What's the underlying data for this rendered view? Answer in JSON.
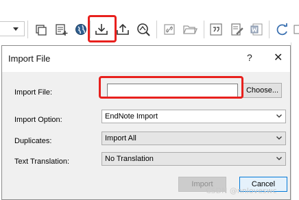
{
  "toolbar": {
    "icons": [
      "show-groups-icon",
      "new-reference-icon",
      "online-search-icon",
      "import-icon",
      "export-icon",
      "find-full-text-icon",
      "open-link-icon",
      "open-file-icon",
      "insert-citation-icon",
      "edit-reference-icon",
      "word-icon",
      "sync-icon"
    ],
    "highlight_color": "#e8201d"
  },
  "dialog": {
    "title": "Import File",
    "help_label": "?",
    "close_label": "✕",
    "import_file": {
      "label": "Import File:",
      "value": "",
      "choose_label": "Choose..."
    },
    "import_option": {
      "label": "Import Option:",
      "value": "EndNote Import"
    },
    "duplicates": {
      "label": "Duplicates:",
      "value": "Import All"
    },
    "text_translation": {
      "label": "Text Translation:",
      "value": "No Translation"
    },
    "buttons": {
      "import_label": "Import",
      "cancel_label": "Cancel"
    }
  },
  "watermark": "CSDN @nnloveswc"
}
